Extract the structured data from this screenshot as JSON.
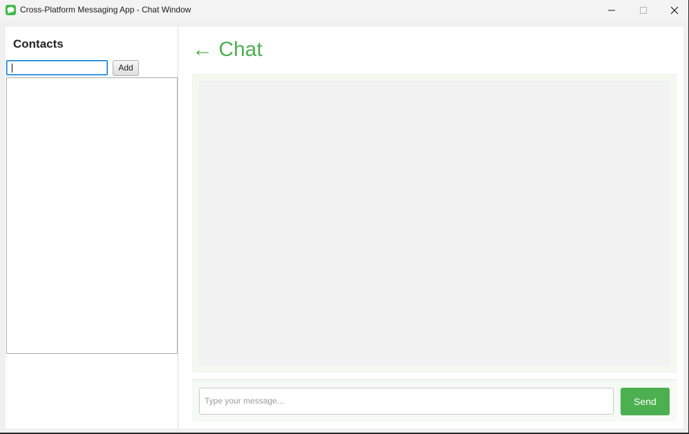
{
  "window": {
    "title": "Cross-Platform Messaging App - Chat Window"
  },
  "sidebar": {
    "title": "Contacts",
    "contact_input": {
      "value": "",
      "placeholder": ""
    },
    "add_label": "Add",
    "contacts": []
  },
  "chat": {
    "header": "← Chat",
    "messages": [],
    "message_input": {
      "value": "",
      "placeholder": "Type your message..."
    },
    "send_label": "Send"
  },
  "colors": {
    "accent": "#4caf50",
    "focus_border": "#0078d4"
  },
  "icons": {
    "app": "chat-bubble-icon",
    "minimize": "minimize-icon",
    "maximize": "maximize-icon",
    "close": "close-icon"
  }
}
